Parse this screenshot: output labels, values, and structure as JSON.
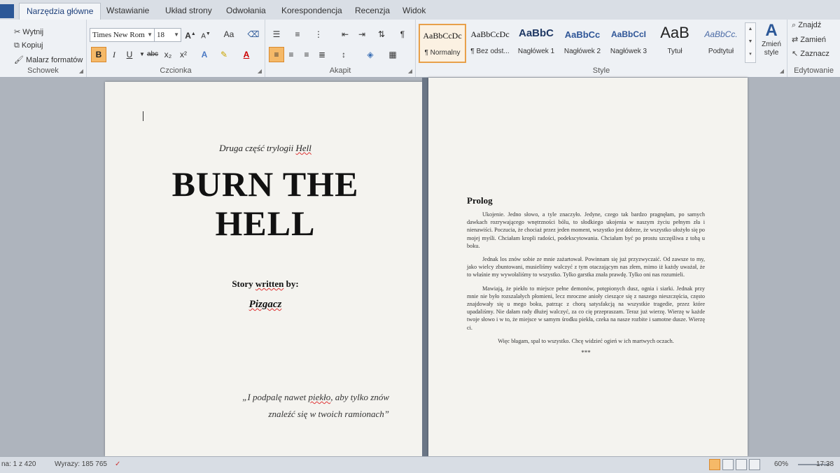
{
  "ribbon": {
    "tabs": [
      "Narzędzia główne",
      "Wstawianie",
      "Układ strony",
      "Odwołania",
      "Korespondencja",
      "Recenzja",
      "Widok"
    ],
    "clipboard": {
      "label": "Schowek",
      "cut": "Wytnij",
      "copy": "Kopiuj",
      "painter": "Malarz formatów"
    },
    "font": {
      "label": "Czcionka",
      "name": "Times New Rom",
      "size": "18",
      "bold": "B",
      "italic": "I",
      "underline": "U",
      "strike": "abc",
      "sub": "x₂",
      "sup": "x²",
      "grow": "A",
      "shrink": "A",
      "case": "Aa",
      "color_letter": "A",
      "effects_letter": "A"
    },
    "paragraph": {
      "label": "Akapit",
      "pilcrow": "¶"
    },
    "styles": {
      "label": "Style",
      "items": [
        {
          "sample": "AaBbCcDc",
          "name": "¶ Normalny"
        },
        {
          "sample": "AaBbCcDc",
          "name": "¶ Bez odst..."
        },
        {
          "sample": "AaBbC",
          "name": "Nagłówek 1"
        },
        {
          "sample": "AaBbCc",
          "name": "Nagłówek 2"
        },
        {
          "sample": "AaBbCcI",
          "name": "Nagłówek 3"
        },
        {
          "sample": "AaB",
          "name": "Tytuł"
        },
        {
          "sample": "AaBbCc.",
          "name": "Podtytuł"
        }
      ],
      "change_label": "Zmień",
      "change_label2": "style",
      "change_letter": "A"
    },
    "editing": {
      "label": "Edytowanie",
      "find": "Znajdź",
      "replace": "Zamień",
      "select": "Zaznacz"
    }
  },
  "page1": {
    "subtitle_pre": "Druga część trylogii ",
    "subtitle_hell": "Hell",
    "title_line1": "BURN THE",
    "title_line2": "HELL",
    "story_pre": "Story ",
    "story_written": "written",
    "story_by": " by:",
    "author": "Pizgacz",
    "quote_pre": "„I podpalę nawet ",
    "quote_word": "piekło",
    "quote_post": ", aby tylko znów",
    "quote_line2": "znaleźć się w twoich ramionach”"
  },
  "page2": {
    "heading": "Prolog",
    "paragraphs": [
      "Ukojenie. Jedno słowo, a tyle znaczyło. Jedyne, czego tak bardzo pragnęłam, po samych dawkach rozrywającego wnętrzności bólu, to słodkiego ukojenia w naszym życiu pełnym zła i nienawiści. Poczucia, że chociaż przez jeden moment, wszystko jest dobrze, że wszystko ułożyło się po mojej myśli. Chciałam kropli radości, podekscytowania. Chciałam być po prostu szczęśliwa z tobą u boku.",
      "Jednak los znów sobie ze mnie zażartował. Powinnam się już przyzwyczaić. Od zawsze to my, jako wielcy zbuntowani, musieliśmy walczyć z tym otaczającym nas złem, mimo iż każdy uważał, że to właśnie my wywołaliśmy to wszystko. Tylko garstka znała prawdę. Tylko oni nas rozumieli.",
      "Mawiają, że piekło to miejsce pełne demonów, potępionych dusz, ognia i siarki. Jednak przy mnie nie było rozszalałych płomieni, lecz mroczne anioły cieszące się z naszego nieszczęścia, często znajdowały się u mego boku, patrząc z chorą satysfakcją na wszystkie tragedie, przez które upadaliśmy. Nie dałam rady dłużej walczyć, za co cię przepraszam. Teraz już wierzę. Wierzę w każde twoje słowo i w to, że miejsce w samym środku piekła, czeka na nasze rozbite i samotne dusze. Wierzę ci.",
      "Więc błagam, spal to wszystko. Chcę widzieć ogień w ich martwych oczach."
    ],
    "separator": "***"
  },
  "statusbar": {
    "page": "na: 1 z 420",
    "words": "Wyrazy: 185 765",
    "zoom": "60%",
    "time": "17:38",
    "chevrons": "»"
  }
}
